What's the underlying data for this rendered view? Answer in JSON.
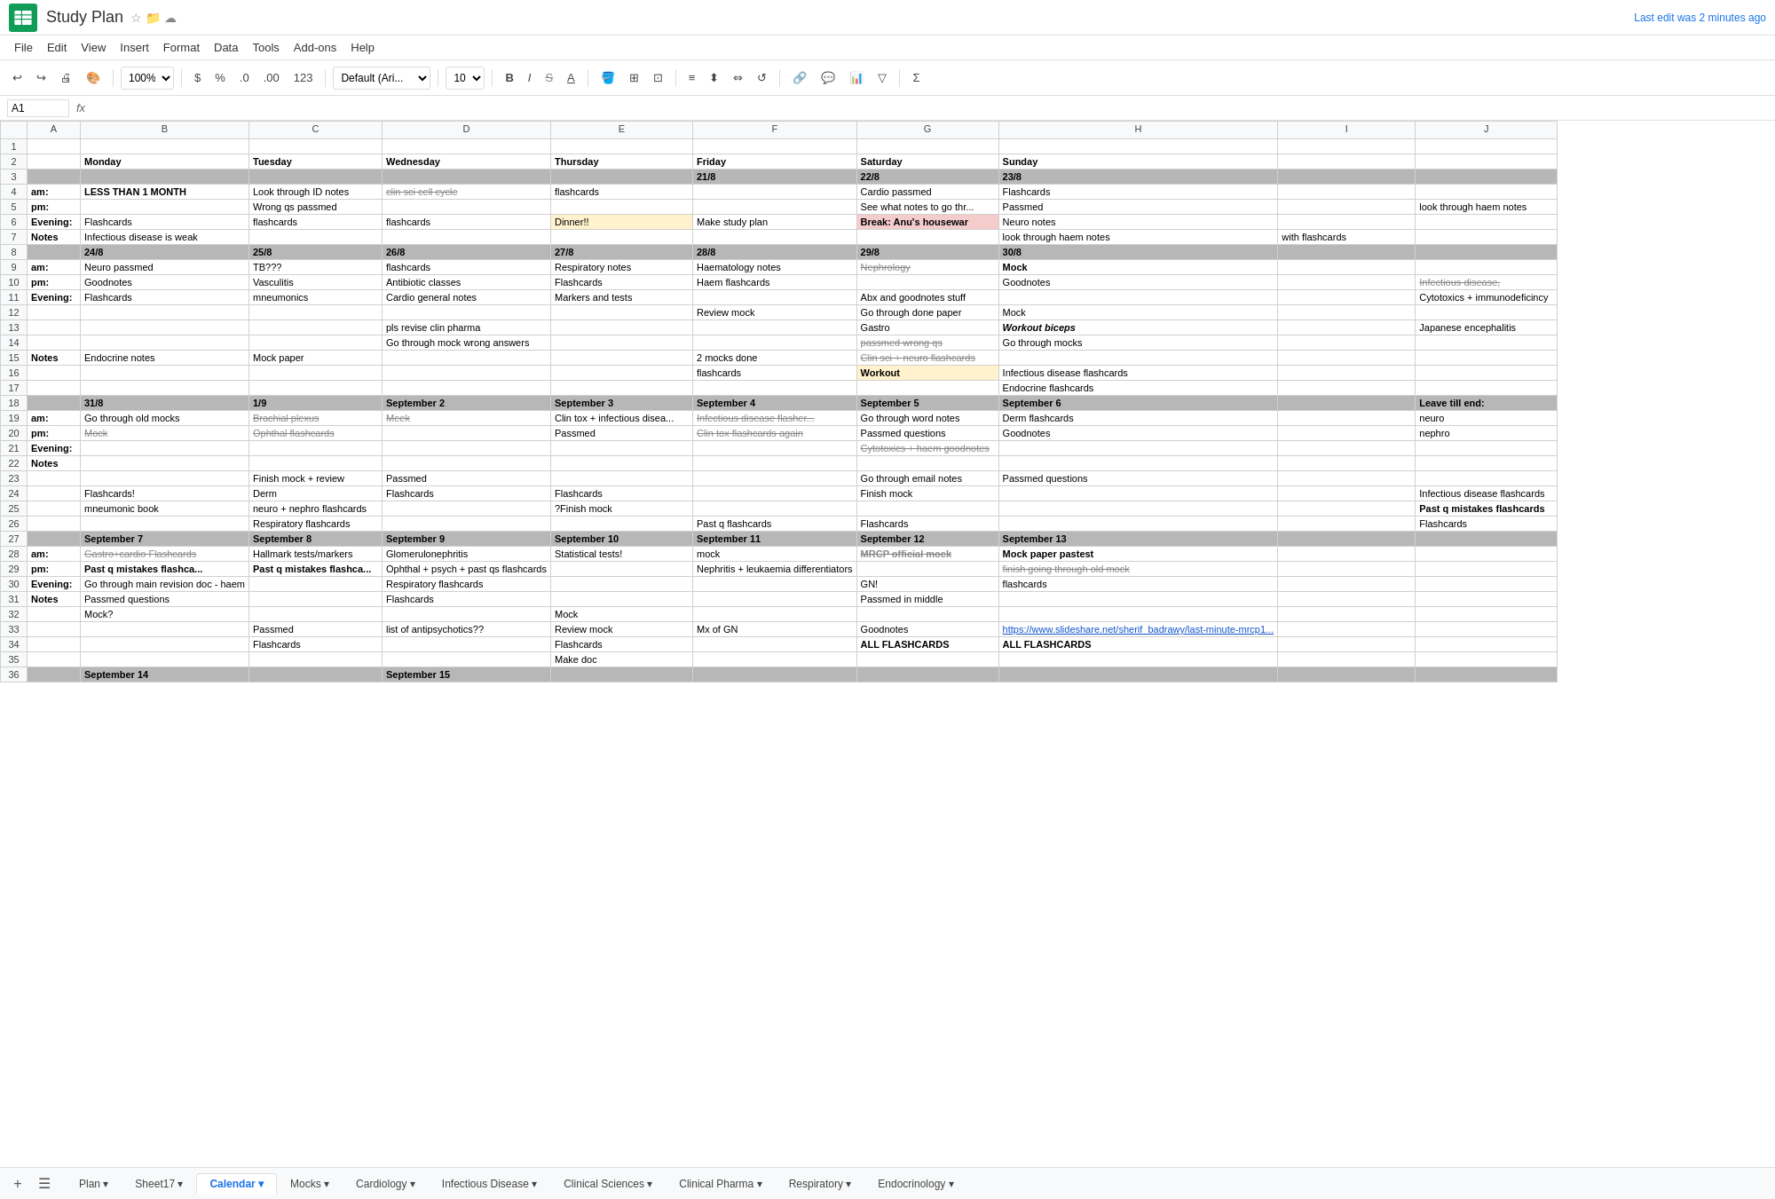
{
  "title": "Study Plan",
  "last_edit": "Last edit was 2 minutes ago",
  "menu": [
    "File",
    "Edit",
    "View",
    "Insert",
    "Format",
    "Data",
    "Tools",
    "Add-ons",
    "Help"
  ],
  "toolbar": {
    "zoom": "100%",
    "currency": "$",
    "percent": "%",
    "decimal0": ".0",
    "decimal00": ".00",
    "format123": "123",
    "font": "Default (Ari...",
    "font_size": "10"
  },
  "cell_ref": "A1",
  "col_headers": [
    "",
    "A",
    "B",
    "C",
    "D",
    "E",
    "F",
    "G",
    "H",
    "I",
    "J"
  ],
  "tabs": [
    {
      "label": "Plan",
      "active": false
    },
    {
      "label": "Sheet17",
      "active": false
    },
    {
      "label": "Calendar",
      "active": true
    },
    {
      "label": "Mocks",
      "active": false
    },
    {
      "label": "Cardiology",
      "active": false
    },
    {
      "label": "Infectious Disease",
      "active": false
    },
    {
      "label": "Clinical Sciences",
      "active": false
    },
    {
      "label": "Clinical Pharma",
      "active": false
    },
    {
      "label": "Respiratory",
      "active": false
    },
    {
      "label": "Endocrinology",
      "active": false
    }
  ],
  "rows": {
    "r2": [
      "",
      "Monday",
      "Tuesday",
      "Wednesday",
      "Thursday",
      "Friday",
      "Saturday",
      "Sunday",
      "",
      ""
    ],
    "r3": [
      "",
      "",
      "",
      "",
      "",
      "",
      "21/8",
      "22/8",
      "23/8",
      "",
      ""
    ],
    "r4": [
      "am:",
      "LESS THAN 1 MONTH",
      "Look through ID notes",
      "clin sci cell cycle",
      "flashcards",
      "",
      "Cardio passmed",
      "Flashcards",
      "",
      "",
      ""
    ],
    "r5": [
      "pm:",
      "",
      "Wrong qs passmed",
      "",
      "",
      "",
      "See what notes to go thr...",
      "Passmed",
      "",
      "look through haem notes",
      ""
    ],
    "r6": [
      "Evening:",
      "Flashcards",
      "flashcards",
      "flashcards",
      "Dinner!!",
      "Make study plan",
      "Break: Anu's housewar",
      "Neuro notes",
      "",
      "",
      ""
    ],
    "r7": [
      "Notes",
      "Infectious disease is weak",
      "",
      "",
      "",
      "",
      "",
      "look through haem notes",
      "with flashcards",
      "",
      ""
    ],
    "r8": [
      "",
      "24/8",
      "25/8",
      "26/8",
      "27/8",
      "28/8",
      "29/8",
      "30/8",
      "",
      "",
      ""
    ],
    "r9": [
      "am:",
      "Neuro passmed",
      "TB???",
      "flashcards",
      "Respiratory notes",
      "Haematology notes",
      "Nephrology",
      "Mock",
      "",
      "",
      ""
    ],
    "r10": [
      "pm:",
      "Goodnotes",
      "Vasculitis",
      "Antibiotic classes",
      "Flashcards",
      "Haem flashcards",
      "",
      "Goodnotes",
      "",
      "Infectious disease,",
      ""
    ],
    "r11": [
      "Evening:",
      "Flashcards",
      "mneumonics",
      "Cardio general notes",
      "Markers and tests",
      "",
      "Abx and goodnotes stuff",
      "",
      "",
      "Cytotoxics + immunodeficincy",
      ""
    ],
    "r12": [
      "",
      "",
      "",
      "",
      "",
      "",
      "Review mock",
      "Go through done paper",
      "Mock",
      "",
      ""
    ],
    "r13": [
      "",
      "",
      "",
      "pls revise clin pharma",
      "",
      "",
      "Gastro",
      "Workout biceps",
      "",
      "Japanese encephalitis",
      ""
    ],
    "r14": [
      "",
      "",
      "",
      "Go through mock wrong answers",
      "",
      "",
      "passmed wrong qs",
      "Go through mocks",
      "",
      "",
      ""
    ],
    "r15": [
      "Notes",
      "Endocrine notes",
      "Mock paper",
      "",
      "",
      "2 mocks done",
      "Clin sci + neuro flashcards",
      "",
      "",
      "",
      ""
    ],
    "r16": [
      "",
      "",
      "",
      "",
      "",
      "flashcards",
      "",
      "Workout",
      "Infectious disease flashcards",
      "",
      ""
    ],
    "r17": [
      "",
      "",
      "",
      "",
      "",
      "",
      "",
      "",
      "Endocrine flashcards",
      "",
      ""
    ],
    "r18": [
      "",
      "31/8",
      "1/9",
      "September 2",
      "September 3",
      "September 4",
      "September 5",
      "September 6",
      "",
      "",
      "Leave till end:"
    ],
    "r19": [
      "am:",
      "Go through old mocks",
      "Brachial plexus",
      "Meek",
      "Clin tox + infectious disea...",
      "Infectious disease flasher...",
      "Go through word notes",
      "Derm flashcards",
      "",
      "neuro",
      ""
    ],
    "r20": [
      "pm:",
      "Mock",
      "Ophthal flashcards",
      "",
      "Passmed",
      "Clin tox flashcards again",
      "Passmed questions",
      "Goodnotes",
      "",
      "nephro",
      ""
    ],
    "r21": [
      "Evening:",
      "",
      "",
      "",
      "",
      "",
      "Cytotoxics + haem goodnotes",
      "",
      "",
      "",
      ""
    ],
    "r22": [
      "Notes",
      "",
      "",
      "",
      "",
      "",
      "",
      "",
      "",
      "",
      ""
    ],
    "r23": [
      "",
      "",
      "Finish mock + review",
      "Passmed",
      "",
      "",
      "Go through email notes",
      "Passmed questions",
      "",
      "",
      ""
    ],
    "r24": [
      "",
      "Flashcards!",
      "Derm",
      "Flashcards",
      "Flashcards",
      "",
      "Finish mock",
      "",
      "",
      "Infectious disease flashcards",
      ""
    ],
    "r25": [
      "",
      "mneumonic book",
      "neuro + nephro flashcards",
      "",
      "?Finish mock",
      "",
      "",
      "",
      "",
      "Past q mistakes flashcards",
      ""
    ],
    "r26": [
      "",
      "",
      "Respiratory flashcards",
      "",
      "",
      "Past q flashcards",
      "Flashcards",
      "",
      "",
      "Flashcards",
      ""
    ],
    "r27": [
      "",
      "September 7",
      "September 8",
      "September 9",
      "September 10",
      "September 11",
      "September 12",
      "September 13",
      "",
      "",
      ""
    ],
    "r28": [
      "am:",
      "Gastro+cardio Flashcards",
      "Hallmark tests/markers",
      "Glomerulonephritis",
      "Statistical tests!",
      "mock",
      "MRCP official mock",
      "Mock paper pastest",
      "",
      "",
      ""
    ],
    "r29": [
      "pm:",
      "Past q mistakes flashca...",
      "Past q mistakes flashca...",
      "Ophthal + psych + past qs flashcards",
      "",
      "Nephritis + leukaemia differentiators",
      "",
      "finish going through old mock",
      "",
      "",
      ""
    ],
    "r30": [
      "Evening:",
      "Go through main revision doc - haem",
      "",
      "Respiratory flashcards",
      "",
      "",
      "GN!",
      "flashcards",
      "",
      "",
      ""
    ],
    "r31": [
      "Notes",
      "Passmed questions",
      "",
      "Flashcards",
      "",
      "",
      "Passmed in middle",
      "",
      "",
      "",
      ""
    ],
    "r32": [
      "",
      "Mock?",
      "",
      "",
      "Mock",
      "",
      "",
      "",
      "",
      "",
      ""
    ],
    "r33": [
      "",
      "",
      "Passmed",
      "list of antipsychotics??",
      "Review mock",
      "Mx of GN",
      "Goodnotes",
      "https://www.slideshare.net/sherif_badrawy/last-minute-mrcp1...",
      "",
      "",
      ""
    ],
    "r34": [
      "",
      "",
      "Flashcards",
      "",
      "Flashcards",
      "",
      "ALL FLASHCARDS",
      "ALL FLASHCARDS",
      "",
      "",
      ""
    ],
    "r35": [
      "",
      "",
      "",
      "",
      "Make doc",
      "",
      "",
      "",
      "",
      "",
      ""
    ],
    "r36": [
      "",
      "September 14",
      "",
      "September 15",
      "",
      "",
      "",
      "",
      "",
      "",
      ""
    ]
  }
}
